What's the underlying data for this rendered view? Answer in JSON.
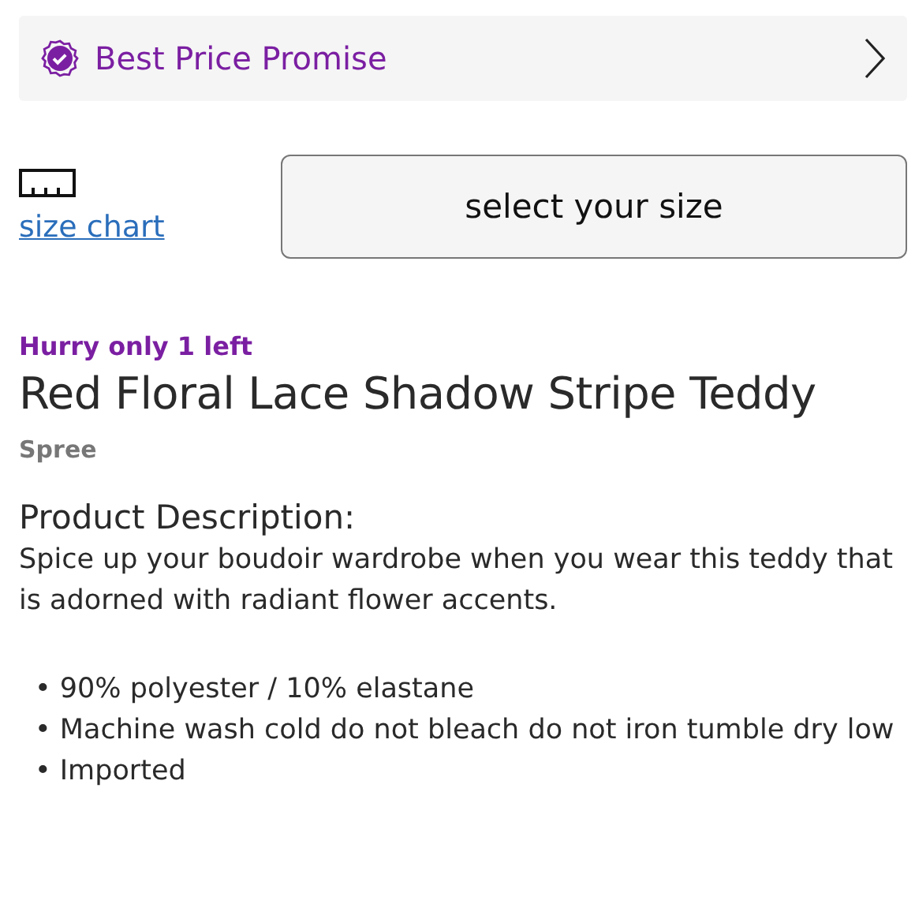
{
  "promise_banner": {
    "label": "Best Price Promise"
  },
  "size_chart_link": "size chart",
  "size_button": "select your size",
  "stock_notice": "Hurry only 1 left",
  "product_title": "Red Floral Lace Shadow Stripe Teddy",
  "brand": "Spree",
  "description_heading": "Product Description:",
  "description": " Spice up your boudoir wardrobe when you wear this teddy that is adorned with radiant flower accents.",
  "features": [
    "• 90% polyester / 10% elastane",
    "• Machine wash cold do not bleach do not iron tumble dry low",
    "• Imported"
  ]
}
